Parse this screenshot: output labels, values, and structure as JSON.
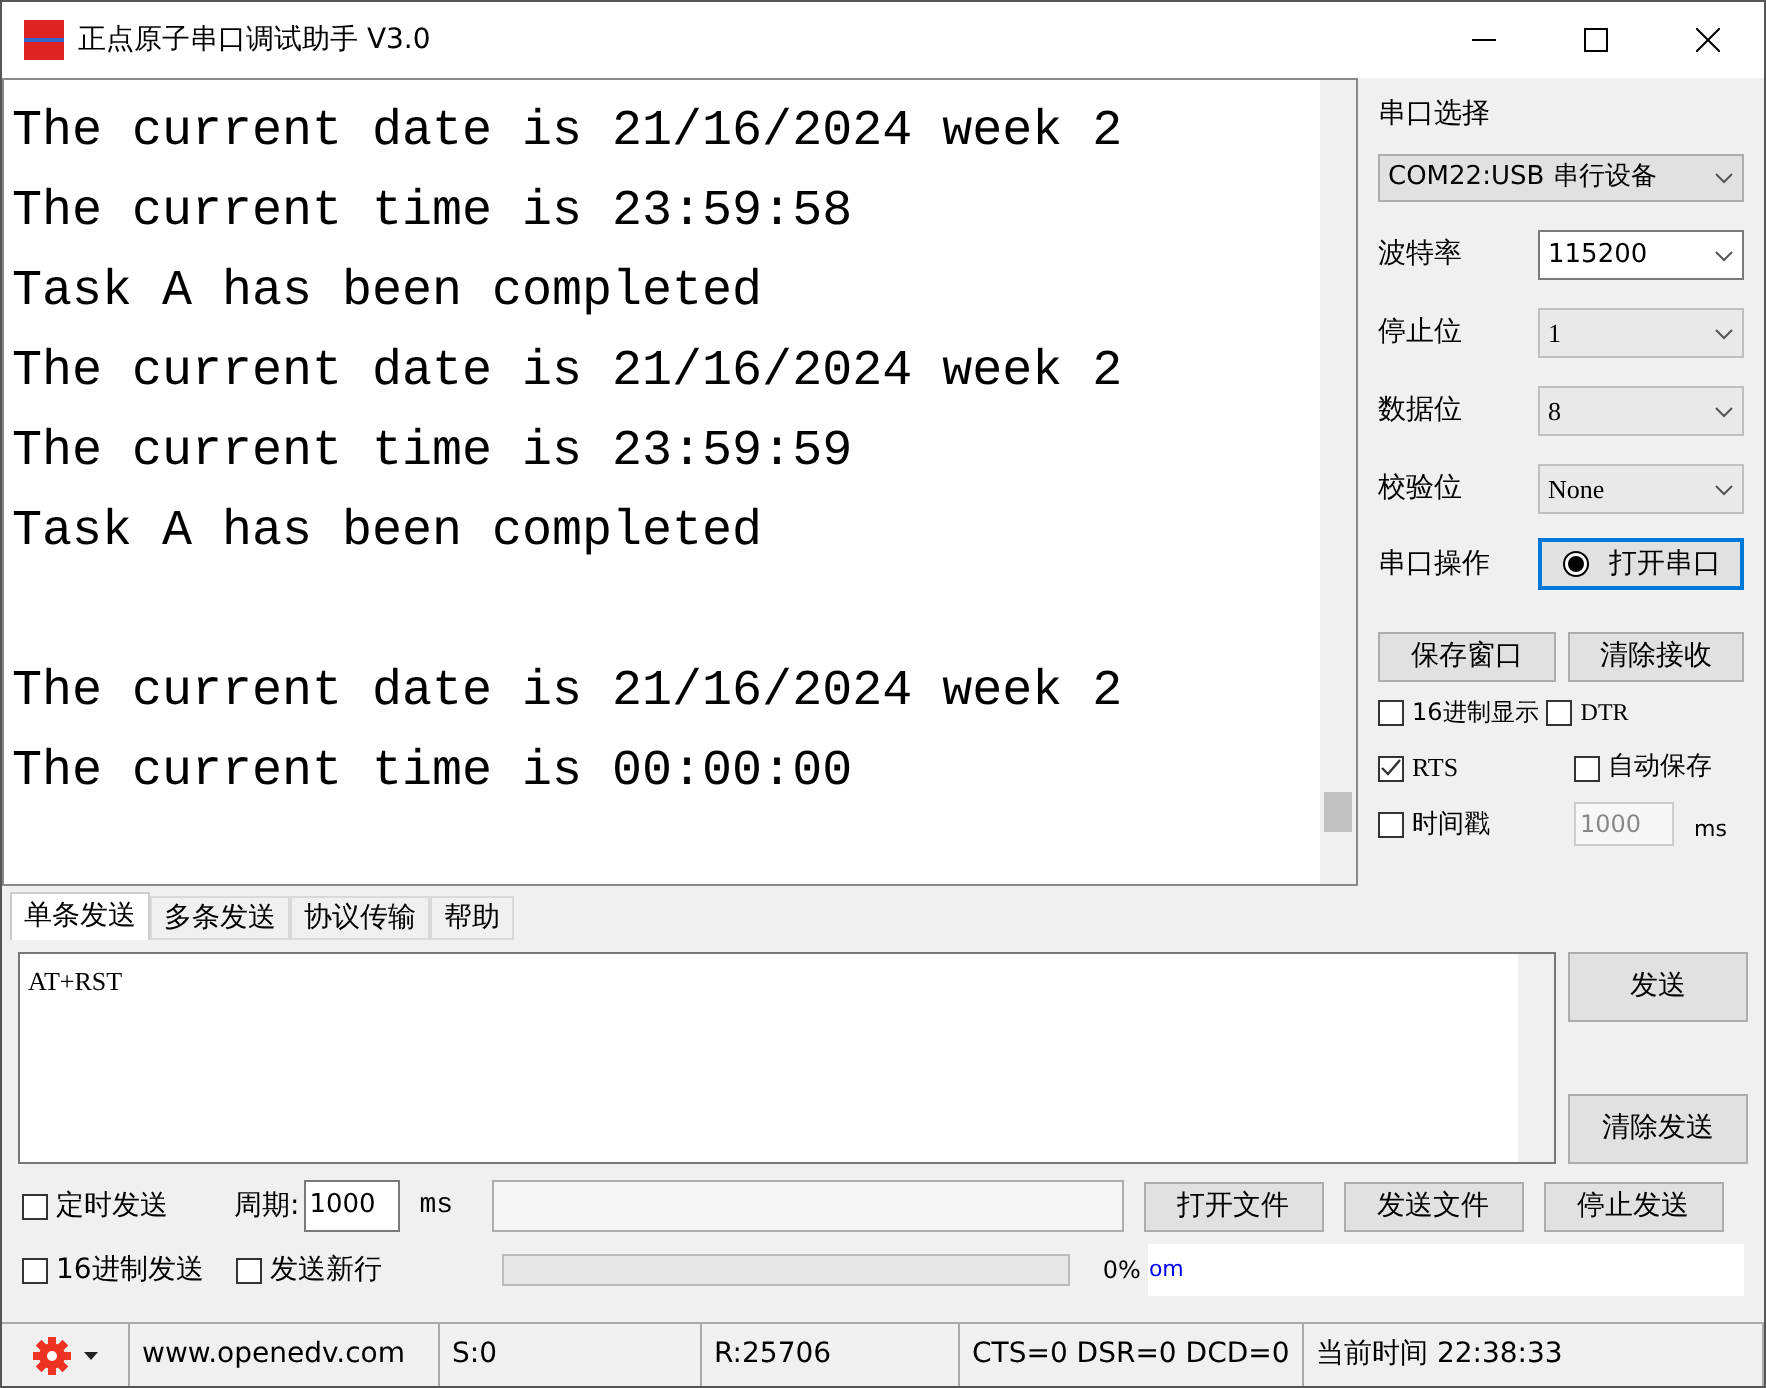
{
  "window": {
    "title": "正点原子串口调试助手 V3.0"
  },
  "receive": {
    "lines": [
      {
        "kind": "text",
        "text": "The current date is 21/16/2024 week 2"
      },
      {
        "kind": "text",
        "text": "The current time is 23:59:58"
      },
      {
        "kind": "text",
        "text": "Task A has been completed"
      },
      {
        "kind": "text",
        "text": "The current date is 21/16/2024 week 2"
      },
      {
        "kind": "text",
        "text": "The current time is 23:59:59"
      },
      {
        "kind": "text",
        "text": "Task A has been completed"
      },
      {
        "kind": "blank"
      },
      {
        "kind": "text",
        "text": "The current date is 21/16/2024 week 2"
      },
      {
        "kind": "text",
        "text": "The current time is 00:00:00"
      }
    ]
  },
  "settings": {
    "title": "串口选择",
    "port": "COM22:USB 串行设备",
    "fields": [
      {
        "label": "波特率",
        "value": "115200",
        "disabled": false
      },
      {
        "label": "停止位",
        "value": "1",
        "disabled": true
      },
      {
        "label": "数据位",
        "value": "8",
        "disabled": true
      },
      {
        "label": "校验位",
        "value": "None",
        "disabled": true
      }
    ],
    "operation_label": "串口操作",
    "open_button": "打开串口",
    "buttons": [
      "保存窗口",
      "清除接收"
    ],
    "options": [
      {
        "label": "16进制显示",
        "checked": false
      },
      {
        "label": "DTR",
        "checked": false
      },
      {
        "label": "RTS",
        "checked": true
      },
      {
        "label": "自动保存",
        "checked": false
      },
      {
        "label": "时间戳",
        "checked": false
      }
    ],
    "timestamp_interval": "1000",
    "timestamp_unit": "ms"
  },
  "tabs": [
    {
      "label": "单条发送",
      "selected": true
    },
    {
      "label": "多条发送",
      "selected": false
    },
    {
      "label": "协议传输",
      "selected": false
    },
    {
      "label": "帮助",
      "selected": false
    }
  ],
  "send": {
    "text": "AT+RST",
    "send_button": "发送",
    "clear_button": "清除发送"
  },
  "bottom": {
    "timed_send": {
      "label": "定时发送",
      "checked": false
    },
    "period_label": "周期:",
    "period": "1000",
    "period_unit": "ms",
    "hex_send": {
      "label": "16进制发送",
      "checked": false
    },
    "newline": {
      "label": "发送新行",
      "checked": false
    },
    "progress_bar": {
      "level": 0
    },
    "progress": "0%",
    "link_fragment": "om",
    "buttons": [
      "打开文件",
      "发送文件",
      "停止发送"
    ]
  },
  "status_bar": {
    "website": "www.openedv.com",
    "sent": "S:0",
    "received": "R:25706",
    "signals": "CTS=0 DSR=0 DCD=0",
    "time": "当前时间 22:38:33"
  }
}
